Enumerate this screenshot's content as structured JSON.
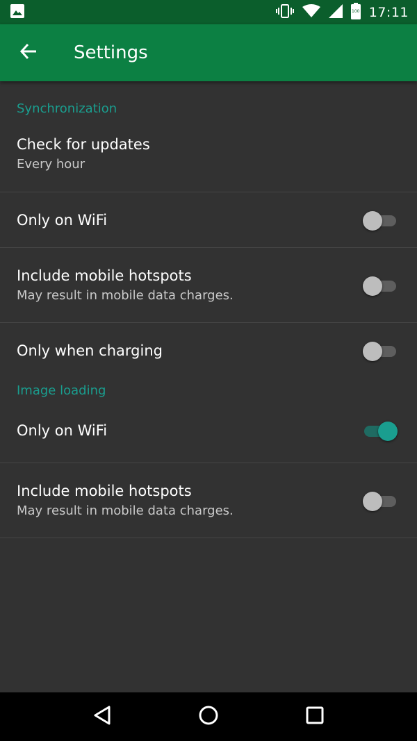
{
  "status_bar": {
    "time": "17:11",
    "battery_level": "100",
    "icons": [
      "image-notification-icon",
      "vibrate-icon",
      "wifi-icon",
      "signal-icon",
      "battery-icon"
    ]
  },
  "app_bar": {
    "title": "Settings",
    "back_icon": "arrow-back-icon",
    "color": "#0c8043"
  },
  "colors": {
    "accent": "#1a9e8f",
    "background": "#323232",
    "status_bar": "#0b5e2c"
  },
  "sections": [
    {
      "header": "Synchronization",
      "prefs": [
        {
          "title": "Check for updates",
          "summary": "Every hour"
        },
        {
          "title": "Only on WiFi",
          "switch_on": false
        },
        {
          "title": "Include mobile hotspots",
          "summary": "May result in mobile data charges.",
          "switch_on": false
        },
        {
          "title": "Only when charging",
          "switch_on": false
        }
      ]
    },
    {
      "header": "Image loading",
      "prefs": [
        {
          "title": "Only on WiFi",
          "switch_on": true
        },
        {
          "title": "Include mobile hotspots",
          "summary": "May result in mobile data charges.",
          "switch_on": false
        }
      ]
    }
  ],
  "nav_bar": {
    "icons": [
      "back-triangle-icon",
      "home-circle-icon",
      "recents-square-icon"
    ]
  }
}
